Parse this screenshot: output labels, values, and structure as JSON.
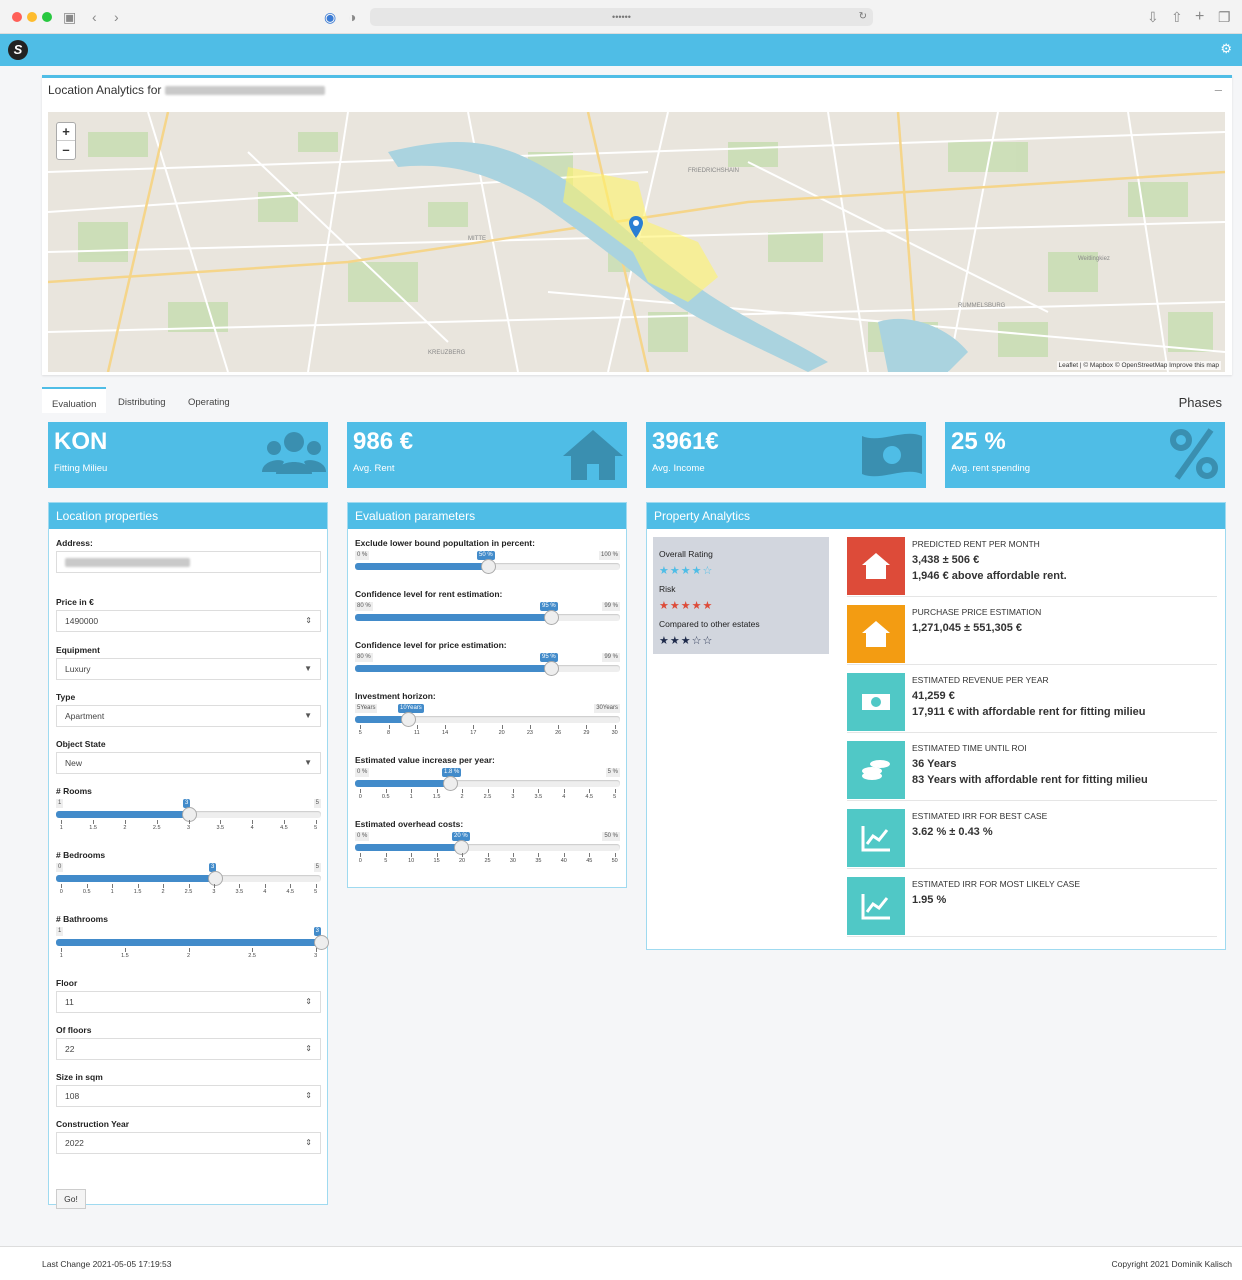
{
  "browser": {
    "url": "••••••"
  },
  "map_header": {
    "title_prefix": "Location Analytics for",
    "collapse": "–"
  },
  "map": {
    "zoom_in": "+",
    "zoom_out": "–",
    "attribution": "Leaflet | © Mapbox © OpenStreetMap Improve this map",
    "labels": [
      "FRIEDRICHSHAIN",
      "KREUZBERG",
      "MITTE",
      "RUMMELSBURG",
      "Weitlingkiez"
    ]
  },
  "tabs": [
    "Evaluation",
    "Distributing",
    "Operating"
  ],
  "phases_label": "Phases",
  "value_boxes": [
    {
      "value": "KON",
      "label": "Fitting Milieu",
      "icon": "users-icon"
    },
    {
      "value": "986 €",
      "label": "Avg. Rent",
      "icon": "home-icon"
    },
    {
      "value": "3961€",
      "label": "Avg. Income",
      "icon": "money-icon"
    },
    {
      "value": "25 %",
      "label": "Avg. rent spending",
      "icon": "percent-icon"
    }
  ],
  "location_properties": {
    "title": "Location properties",
    "address_label": "Address:",
    "price_label": "Price in €",
    "price_value": "1490000",
    "equipment_label": "Equipment",
    "equipment_value": "Luxury",
    "type_label": "Type",
    "type_value": "Apartment",
    "object_state_label": "Object State",
    "object_state_value": "New",
    "rooms_label": "# Rooms",
    "rooms_min": "1",
    "rooms_max": "5",
    "rooms_value": "3",
    "rooms_ticks": [
      "1",
      "1.5",
      "2",
      "2.5",
      "3",
      "3.5",
      "4",
      "4.5",
      "5"
    ],
    "bedrooms_label": "# Bedrooms",
    "bedrooms_min": "0",
    "bedrooms_max": "5",
    "bedrooms_value": "3",
    "bedrooms_ticks": [
      "0",
      "0.5",
      "1",
      "1.5",
      "2",
      "2.5",
      "3",
      "3.5",
      "4",
      "4.5",
      "5"
    ],
    "bathrooms_label": "# Bathrooms",
    "bathrooms_min": "1",
    "bathrooms_value": "3",
    "bathrooms_ticks": [
      "1",
      "1.5",
      "2",
      "2.5",
      "3"
    ],
    "floor_label": "Floor",
    "floor_value": "11",
    "of_floors_label": "Of floors",
    "of_floors_value": "22",
    "size_label": "Size in sqm",
    "size_value": "108",
    "construction_label": "Construction Year",
    "construction_value": "2022",
    "go_label": "Go!"
  },
  "evaluation_parameters": {
    "title": "Evaluation parameters",
    "s1": {
      "label": "Exclude lower bound popultation in percent:",
      "min": "0 %",
      "max": "100 %",
      "value": "50 %"
    },
    "s2": {
      "label": "Confidence level for rent estimation:",
      "min": "80 %",
      "max": "99 %",
      "value": "95 %"
    },
    "s3": {
      "label": "Confidence level for price estimation:",
      "min": "80 %",
      "max": "99 %",
      "value": "95 %"
    },
    "s4": {
      "label": "Investment horizon:",
      "min": "5Years",
      "max": "30Years",
      "value": "10Years",
      "ticks": [
        "5",
        "8",
        "11",
        "14",
        "17",
        "20",
        "23",
        "26",
        "29",
        "30"
      ]
    },
    "s5": {
      "label": "Estimated value increase per year:",
      "min": "0 %",
      "max": "5 %",
      "value": "1.8 %",
      "ticks": [
        "0",
        "0.5",
        "1",
        "1.5",
        "2",
        "2.5",
        "3",
        "3.5",
        "4",
        "4.5",
        "5"
      ]
    },
    "s6": {
      "label": "Estimated overhead costs:",
      "min": "0 %",
      "max": "50 %",
      "value": "20 %",
      "ticks": [
        "0",
        "5",
        "10",
        "15",
        "20",
        "25",
        "30",
        "35",
        "40",
        "45",
        "50"
      ]
    }
  },
  "property_analytics": {
    "title": "Property Analytics",
    "overall_rating_label": "Overall Rating",
    "overall_rating": 4,
    "risk_label": "Risk",
    "risk_rating": 5,
    "compared_label": "Compared to other estates",
    "compared_rating": 3,
    "rows": [
      {
        "title": "Predicted rent per month",
        "v1": "3,438 ± 506 €",
        "v2": "1,946 € above affordable rent.",
        "color": "#dd4b39",
        "icon": "home-icon"
      },
      {
        "title": "Purchase price estimation",
        "v1": "1,271,045 ± 551,305 €",
        "v2": "",
        "color": "#f39c12",
        "icon": "home-icon"
      },
      {
        "title": "Estimated revenue per year",
        "v1": "41,259 €",
        "v2": "17,911 € with affordable rent for fitting milieu",
        "color": "#50c8c6",
        "icon": "money-icon"
      },
      {
        "title": "Estimated time until ROI",
        "v1": "36 Years",
        "v2": "83 Years with affordable rent for fitting milieu",
        "color": "#50c8c6",
        "icon": "coins-icon"
      },
      {
        "title": "Estimated IRR for best case",
        "v1": "3.62 % ± 0.43 %",
        "v2": "",
        "color": "#50c8c6",
        "icon": "chart-icon"
      },
      {
        "title": "Estimated IRR for most likely case",
        "v1": "1.95 %",
        "v2": "",
        "color": "#50c8c6",
        "icon": "chart-icon"
      }
    ]
  },
  "footer": {
    "left": "Last Change 2021-05-05 17:19:53",
    "right": "Copyright 2021 Dominik Kalisch"
  },
  "colors": {
    "primary": "#4fbde6",
    "slider": "#428bca"
  }
}
